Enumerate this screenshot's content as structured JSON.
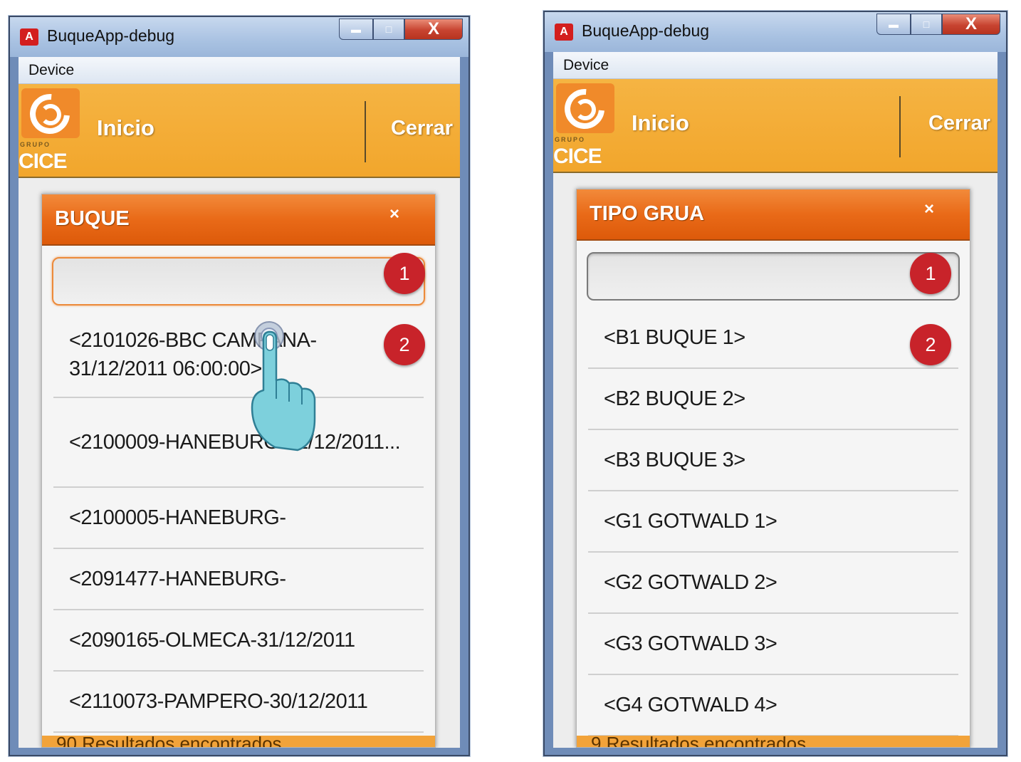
{
  "left_window": {
    "title": "BuqueApp-debug",
    "menu": "Device",
    "header": {
      "inicio": "Inicio",
      "cerrar": "Cerrar",
      "logo_text": "CICE",
      "logo_sub": "GRUPO"
    },
    "panel_title": "BUQUE",
    "close_glyph": "×",
    "search_value": "",
    "results": [
      "<2101026-BBC CAMPANA-31/12/2011 06:00:00>",
      "<2100009-HANEBURG-31/12/2011...",
      "<2100005-HANEBURG-",
      "<2091477-HANEBURG-",
      "<2090165-OLMECA-31/12/2011",
      "<2110073-PAMPERO-30/12/2011"
    ],
    "footer": "90 Resultados encontrados"
  },
  "right_window": {
    "title": "BuqueApp-debug",
    "menu": "Device",
    "header": {
      "inicio": "Inicio",
      "cerrar": "Cerrar",
      "logo_text": "CICE",
      "logo_sub": "GRUPO"
    },
    "panel_title": "TIPO GRUA",
    "close_glyph": "×",
    "search_value": "",
    "results": [
      "<B1 BUQUE 1>",
      "<B2 BUQUE 2>",
      "<B3 BUQUE 3>",
      "<G1 GOTWALD 1>",
      "<G2 GOTWALD 2>",
      "<G3 GOTWALD 3>",
      "<G4 GOTWALD 4>"
    ],
    "footer": "9 Resultados encontrados"
  },
  "callouts": {
    "one": "1",
    "two": "2"
  },
  "window_controls": {
    "minimize": "▬",
    "maximize": "□",
    "close": "X"
  },
  "colors": {
    "header": "#f2a62c",
    "panel_header": "#e96a18",
    "badge": "#c8232a",
    "hand": "#7dd0dc"
  },
  "icons": {
    "app": "adobe-air-icon",
    "pointer": "tap-hand-icon"
  }
}
